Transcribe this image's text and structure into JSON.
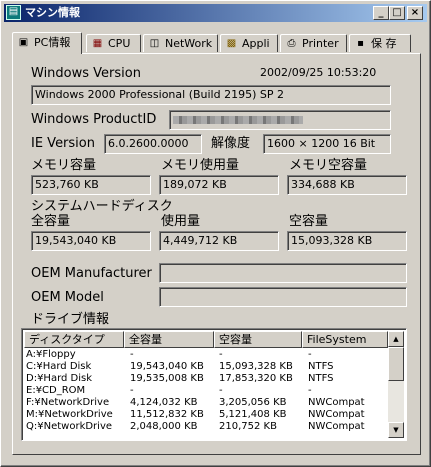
{
  "window": {
    "title": "マシン情報"
  },
  "tabs": [
    {
      "label": "PC情報",
      "icon": "pc-icon"
    },
    {
      "label": "CPU",
      "icon": "cpu-icon"
    },
    {
      "label": "NetWork",
      "icon": "network-icon"
    },
    {
      "label": "Appli",
      "icon": "appli-icon"
    },
    {
      "label": "Printer",
      "icon": "printer-icon"
    },
    {
      "label": "保 存",
      "icon": "save-icon"
    }
  ],
  "pc": {
    "windows_version_label": "Windows Version",
    "datetime": "2002/09/25 10:53:20",
    "windows_version": "Windows 2000 Professional (Build 2195) SP 2",
    "product_id_label": "Windows ProductID",
    "ie_version_label": "IE Version",
    "ie_version": "6.0.2600.0000",
    "resolution_label": "解像度",
    "resolution": "1600 × 1200 16 Bit",
    "mem_total_label": "メモリ容量",
    "mem_total": "523,760 KB",
    "mem_used_label": "メモリ使用量",
    "mem_used": "189,072 KB",
    "mem_free_label": "メモリ空容量",
    "mem_free": "334,688 KB",
    "system_disk_label": "システムハードディスク",
    "disk_total_label": "全容量",
    "disk_total": "19,543,040 KB",
    "disk_used_label": "使用量",
    "disk_used": "4,449,712 KB",
    "disk_free_label": "空容量",
    "disk_free": "15,093,328 KB",
    "oem_manufacturer_label": "OEM Manufacturer",
    "oem_manufacturer": "",
    "oem_model_label": "OEM Model",
    "oem_model": "",
    "drive_info_label": "ドライブ情報"
  },
  "drives": {
    "columns": [
      "ディスクタイプ",
      "全容量",
      "空容量",
      "FileSystem"
    ],
    "rows": [
      [
        "A:¥Floppy",
        "-",
        "-",
        "-"
      ],
      [
        "C:¥Hard Disk",
        "19,543,040 KB",
        "15,093,328 KB",
        "NTFS"
      ],
      [
        "D:¥Hard Disk",
        "19,535,008 KB",
        "17,853,320 KB",
        "NTFS"
      ],
      [
        "E:¥CD_ROM",
        "-",
        "-",
        "-"
      ],
      [
        "F:¥NetworkDrive",
        "4,124,032 KB",
        "3,205,056 KB",
        "NWCompat"
      ],
      [
        "M:¥NetworkDrive",
        "11,512,832 KB",
        "5,121,408 KB",
        "NWCompat"
      ],
      [
        "Q:¥NetworkDrive",
        "2,048,000 KB",
        "210,752 KB",
        "NWCompat"
      ]
    ]
  }
}
